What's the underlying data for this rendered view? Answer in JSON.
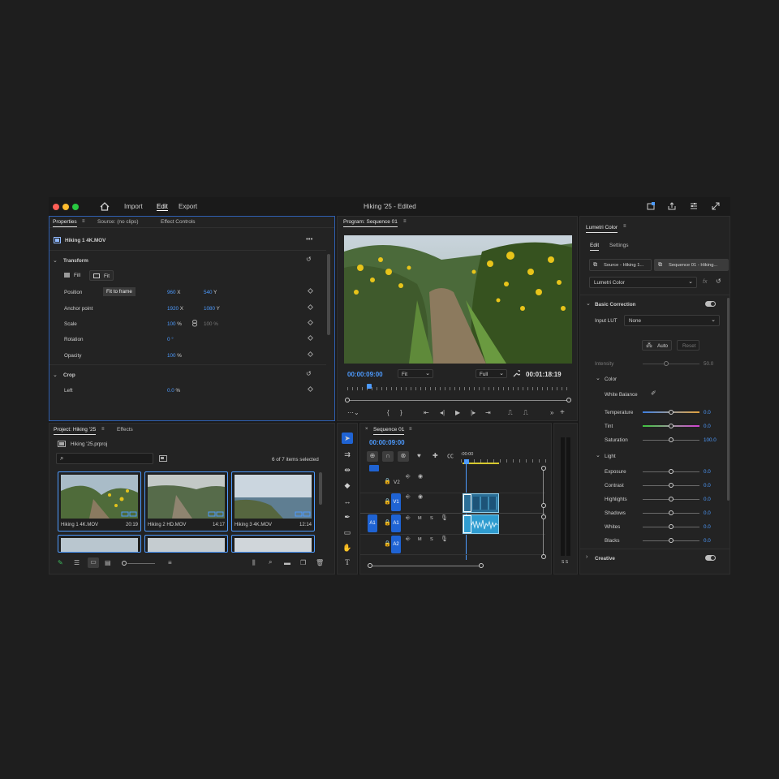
{
  "topbar": {
    "menu": [
      "Import",
      "Edit",
      "Export"
    ],
    "title": "Hiking '25 - Edited"
  },
  "properties": {
    "tabs": [
      "Properties",
      "Source: (no clips)",
      "Effect Controls"
    ],
    "clip_name": "Hiking 1 4K.MOV",
    "transform_label": "Transform",
    "fill_label": "Fill",
    "fit_label": "Fit",
    "tooltip": "Fit to frame",
    "rows": [
      {
        "label": "Position",
        "v1": "960",
        "u1": "X",
        "v2": "540",
        "u2": "Y"
      },
      {
        "label": "Anchor point",
        "v1": "1920",
        "u1": "X",
        "v2": "1080",
        "u2": "Y"
      },
      {
        "label": "Scale",
        "v1": "100",
        "u1": "%",
        "v2": "100",
        "u2": "%"
      },
      {
        "label": "Rotation",
        "v1": "0",
        "u1": "°",
        "v2": "",
        "u2": ""
      },
      {
        "label": "Opacity",
        "v1": "100",
        "u1": "%",
        "v2": "",
        "u2": ""
      }
    ],
    "crop_label": "Crop",
    "crop_left": {
      "label": "Left",
      "value": "0.0",
      "unit": "%"
    }
  },
  "program": {
    "tab": "Program: Sequence 01",
    "timecode": "00:00:09:00",
    "fit": "Fit",
    "quality": "Full",
    "duration": "00:01:18:19"
  },
  "project": {
    "tabs": [
      "Project: Hiking '25",
      "Effects"
    ],
    "file": "Hiking '25.prproj",
    "selection": "6 of 7 items selected",
    "clips": [
      {
        "name": "Hiking 1 4K.MOV",
        "duration": "20:19"
      },
      {
        "name": "Hiking 2 HD.MOV",
        "duration": "14:17"
      },
      {
        "name": "Hiking 3 4K.MOV",
        "duration": "12:14"
      }
    ]
  },
  "timeline": {
    "tab": "Sequence 01",
    "timecode": "00:00:09:00",
    "ruler": ":00:00",
    "tracks": [
      "V2",
      "V1",
      "A1",
      "A1",
      "A2"
    ],
    "m_label": "M",
    "s_label": "S"
  },
  "meter": {
    "label": "S S"
  },
  "lumetri": {
    "tab": "Lumetri Color",
    "subtabs": [
      "Edit",
      "Settings"
    ],
    "source_btn": "Source - Hiking 1...",
    "seq_btn": "Sequence 01 - Hiking...",
    "effect": "Lumetri Color",
    "fx": "fx",
    "basic": "Basic Correction",
    "input_lut_label": "Input LUT",
    "input_lut": "None",
    "auto": "Auto",
    "reset": "Reset",
    "intensity": {
      "label": "Intensity",
      "value": "50.0",
      "level": 0.5
    },
    "color_label": "Color",
    "white_balance": "White Balance",
    "color_sliders": [
      {
        "label": "Temperature",
        "value": "0.0",
        "level": 0.5
      },
      {
        "label": "Tint",
        "value": "0.0",
        "level": 0.5
      },
      {
        "label": "Saturation",
        "value": "100.0",
        "level": 0.5
      }
    ],
    "light_label": "Light",
    "light_sliders": [
      {
        "label": "Exposure",
        "value": "0.0",
        "level": 0.5
      },
      {
        "label": "Contrast",
        "value": "0.0",
        "level": 0.5
      },
      {
        "label": "Highlights",
        "value": "0.0",
        "level": 0.5
      },
      {
        "label": "Shadows",
        "value": "0.0",
        "level": 0.5
      },
      {
        "label": "Whites",
        "value": "0.0",
        "level": 0.5
      },
      {
        "label": "Blacks",
        "value": "0.0",
        "level": 0.5
      }
    ],
    "creative": "Creative"
  },
  "colors": {
    "accent": "#4d9bff",
    "track_blue": "#1f63d3",
    "clip": "#2f8fbf"
  }
}
